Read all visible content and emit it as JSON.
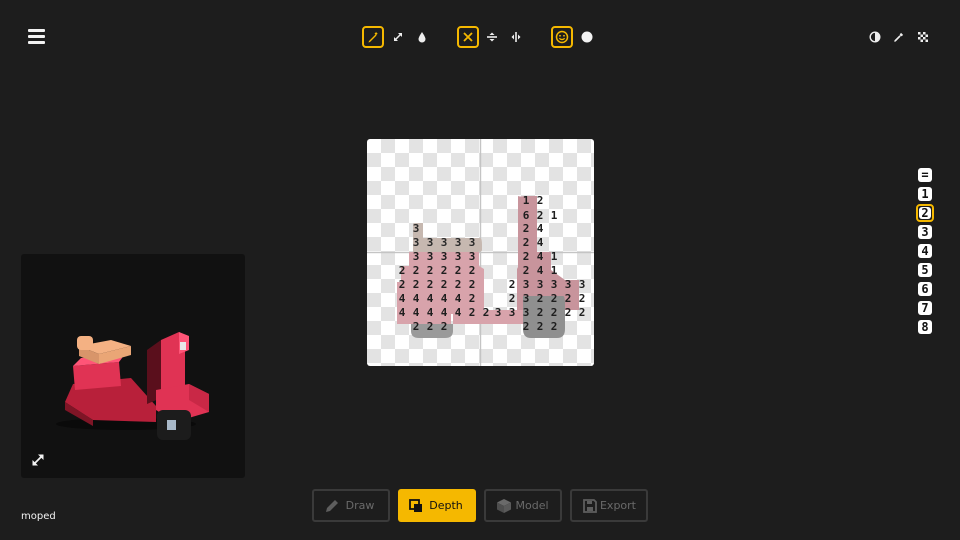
{
  "app": {
    "model_name": "moped"
  },
  "colors": {
    "accent": "#f5b800",
    "background": "#1d1d1d"
  },
  "toolbar": {
    "left": {
      "icon": "hamburger-menu-icon"
    },
    "center_groups": [
      [
        {
          "icon": "pencil-icon",
          "selected": true
        },
        {
          "icon": "resize-arrows-icon",
          "selected": false
        },
        {
          "icon": "droplet-icon",
          "selected": false
        }
      ],
      [
        {
          "icon": "x-mirror-icon",
          "selected": true
        },
        {
          "icon": "flip-vertical-icon",
          "selected": false
        },
        {
          "icon": "flip-horizontal-icon",
          "selected": false
        }
      ],
      [
        {
          "icon": "smiley-icon",
          "selected": true
        },
        {
          "icon": "white-dot-icon",
          "selected": false
        }
      ]
    ],
    "right": [
      {
        "icon": "contrast-icon"
      },
      {
        "icon": "eyedropper-icon"
      },
      {
        "icon": "checkerboard-icon"
      }
    ]
  },
  "layers": {
    "items": [
      "=",
      "1",
      "2",
      "3",
      "4",
      "5",
      "6",
      "7",
      "8"
    ],
    "selected": "2"
  },
  "tabs": [
    {
      "label": "Draw",
      "icon": "pencil-icon",
      "active": false
    },
    {
      "label": "Depth",
      "icon": "depth-layers-icon",
      "active": true
    },
    {
      "label": "Model",
      "icon": "cube-icon",
      "active": false
    },
    {
      "label": "Export",
      "icon": "floppy-disk-icon",
      "active": false
    }
  ],
  "preview": {
    "expand_icon": "expand-arrows-icon"
  },
  "canvas": {
    "rows": [
      {
        "cells": [
          [
            "1",
            "ink"
          ],
          [
            "2",
            "ink"
          ]
        ]
      },
      {
        "cells": [
          [
            "6",
            "ink"
          ],
          [
            "2",
            "ink"
          ],
          [
            "1",
            "ink"
          ]
        ]
      },
      {
        "cells": [
          [
            "3",
            "tan"
          ],
          [
            "2",
            "ink"
          ],
          [
            "4",
            "ink"
          ]
        ]
      },
      {
        "cells": [
          [
            "3",
            "tan"
          ],
          [
            "3",
            "tan"
          ],
          [
            "3",
            "tan"
          ],
          [
            "3",
            "tan"
          ],
          [
            "3",
            "tan"
          ],
          [
            "2",
            "ink"
          ],
          [
            "4",
            "ink"
          ]
        ]
      },
      {
        "cells": [
          [
            "3",
            "ink"
          ],
          [
            "3",
            "ink"
          ],
          [
            "3",
            "ink"
          ],
          [
            "3",
            "ink"
          ],
          [
            "3",
            "ink"
          ],
          [
            "2",
            "ink"
          ],
          [
            "4",
            "ink"
          ],
          [
            "1",
            "ink"
          ]
        ]
      },
      {
        "cells": [
          [
            "2",
            "ink"
          ],
          [
            "2",
            "ink"
          ],
          [
            "2",
            "ink"
          ],
          [
            "2",
            "ink"
          ],
          [
            "2",
            "ink"
          ],
          [
            "2",
            "ink"
          ],
          [
            "2",
            "ink"
          ],
          [
            "4",
            "ink"
          ],
          [
            "1",
            "ink"
          ]
        ]
      },
      {
        "cells": [
          [
            "2",
            "ink"
          ],
          [
            "2",
            "ink"
          ],
          [
            "2",
            "ink"
          ],
          [
            "2",
            "ink"
          ],
          [
            "2",
            "ink"
          ],
          [
            "2",
            "ink"
          ],
          [
            "2",
            "ink"
          ],
          [
            "3",
            "ink"
          ],
          [
            "3",
            "ink"
          ],
          [
            "3",
            "ink"
          ],
          [
            "3",
            "ink"
          ],
          [
            "3",
            "ink"
          ]
        ]
      },
      {
        "cells": [
          [
            "4",
            "ink"
          ],
          [
            "4",
            "ink"
          ],
          [
            "4",
            "ink"
          ],
          [
            "4",
            "ink"
          ],
          [
            "4",
            "ink"
          ],
          [
            "2",
            "ink"
          ],
          [
            "2",
            "ink"
          ],
          [
            "3",
            "ink"
          ],
          [
            "2",
            "ink"
          ],
          [
            "2",
            "ink"
          ],
          [
            "2",
            "ink"
          ],
          [
            "2",
            "ink"
          ]
        ]
      },
      {
        "cells": [
          [
            "4",
            "ink"
          ],
          [
            "4",
            "ink"
          ],
          [
            "4",
            "ink"
          ],
          [
            "4",
            "ink"
          ],
          [
            "4",
            "ink"
          ],
          [
            "2",
            "ink"
          ],
          [
            "2",
            "ink"
          ],
          [
            "3",
            "ink"
          ],
          [
            "3",
            "ink"
          ],
          [
            "3",
            "ink"
          ],
          [
            "2",
            "ink"
          ],
          [
            "2",
            "ink"
          ],
          [
            "2",
            "ink"
          ],
          [
            "2",
            "ink"
          ]
        ]
      },
      {
        "cells": [
          [
            "2",
            "ink"
          ],
          [
            "2",
            "ink"
          ],
          [
            "2",
            "ink"
          ],
          [
            "2",
            "ink"
          ],
          [
            "2",
            "ink"
          ],
          [
            "2",
            "ink"
          ]
        ]
      }
    ]
  }
}
